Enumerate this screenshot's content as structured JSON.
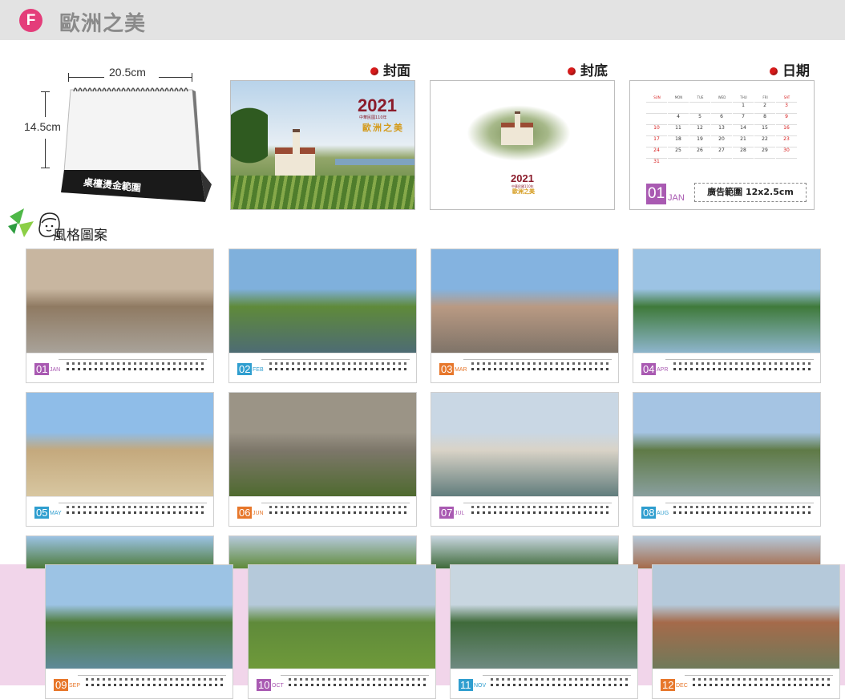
{
  "header": {
    "badge": "F",
    "title": "歐洲之美",
    "badge_color": "#e43d7a"
  },
  "desk_calendar": {
    "width_label": "20.5cm",
    "height_label": "14.5cm",
    "base_label": "桌檯燙金範圍"
  },
  "cards": {
    "front": {
      "label": "封面",
      "year": "2021",
      "subtitle_small": "中華民國110年",
      "title_cn": "歐洲之美"
    },
    "back": {
      "label": "封底",
      "year": "2021",
      "subtitle_small": "中華民國110年",
      "title_cn": "歐洲之美"
    },
    "date": {
      "label": "日期",
      "month_num": "01",
      "month_name": "JAN",
      "ad_text": "廣告範圍 12x2.5cm",
      "weekdays": [
        "SUN",
        "MON",
        "TUE",
        "WED",
        "THU",
        "FRI",
        "SAT"
      ],
      "weeks": [
        [
          "",
          "",
          "",
          "",
          "1",
          "2",
          "3"
        ],
        [
          "",
          "4",
          "5",
          "6",
          "7",
          "8",
          "9"
        ],
        [
          "10",
          "11",
          "12",
          "13",
          "14",
          "15",
          "16"
        ],
        [
          "17",
          "18",
          "19",
          "20",
          "21",
          "22",
          "23"
        ],
        [
          "24",
          "25",
          "26",
          "27",
          "28",
          "29",
          "30"
        ],
        [
          "31",
          "",
          "",
          "",
          "",
          "",
          ""
        ]
      ]
    }
  },
  "style_section": {
    "title": "風格圖案"
  },
  "months": [
    {
      "num": "01",
      "name": "JAN",
      "color": "#a95ab2"
    },
    {
      "num": "02",
      "name": "FEB",
      "color": "#2f9ecf"
    },
    {
      "num": "03",
      "name": "MAR",
      "color": "#e7772b"
    },
    {
      "num": "04",
      "name": "APR",
      "color": "#a95ab2"
    },
    {
      "num": "05",
      "name": "MAY",
      "color": "#2f9ecf"
    },
    {
      "num": "06",
      "name": "JUN",
      "color": "#e7772b"
    },
    {
      "num": "07",
      "name": "JUL",
      "color": "#a95ab2"
    },
    {
      "num": "08",
      "name": "AUG",
      "color": "#2f9ecf"
    },
    {
      "num": "09",
      "name": "SEP",
      "color": "#e7772b"
    },
    {
      "num": "10",
      "name": "OCT",
      "color": "#a95ab2"
    },
    {
      "num": "11",
      "name": "NOV",
      "color": "#2f9ecf"
    },
    {
      "num": "12",
      "name": "DEC",
      "color": "#e7772b"
    }
  ]
}
